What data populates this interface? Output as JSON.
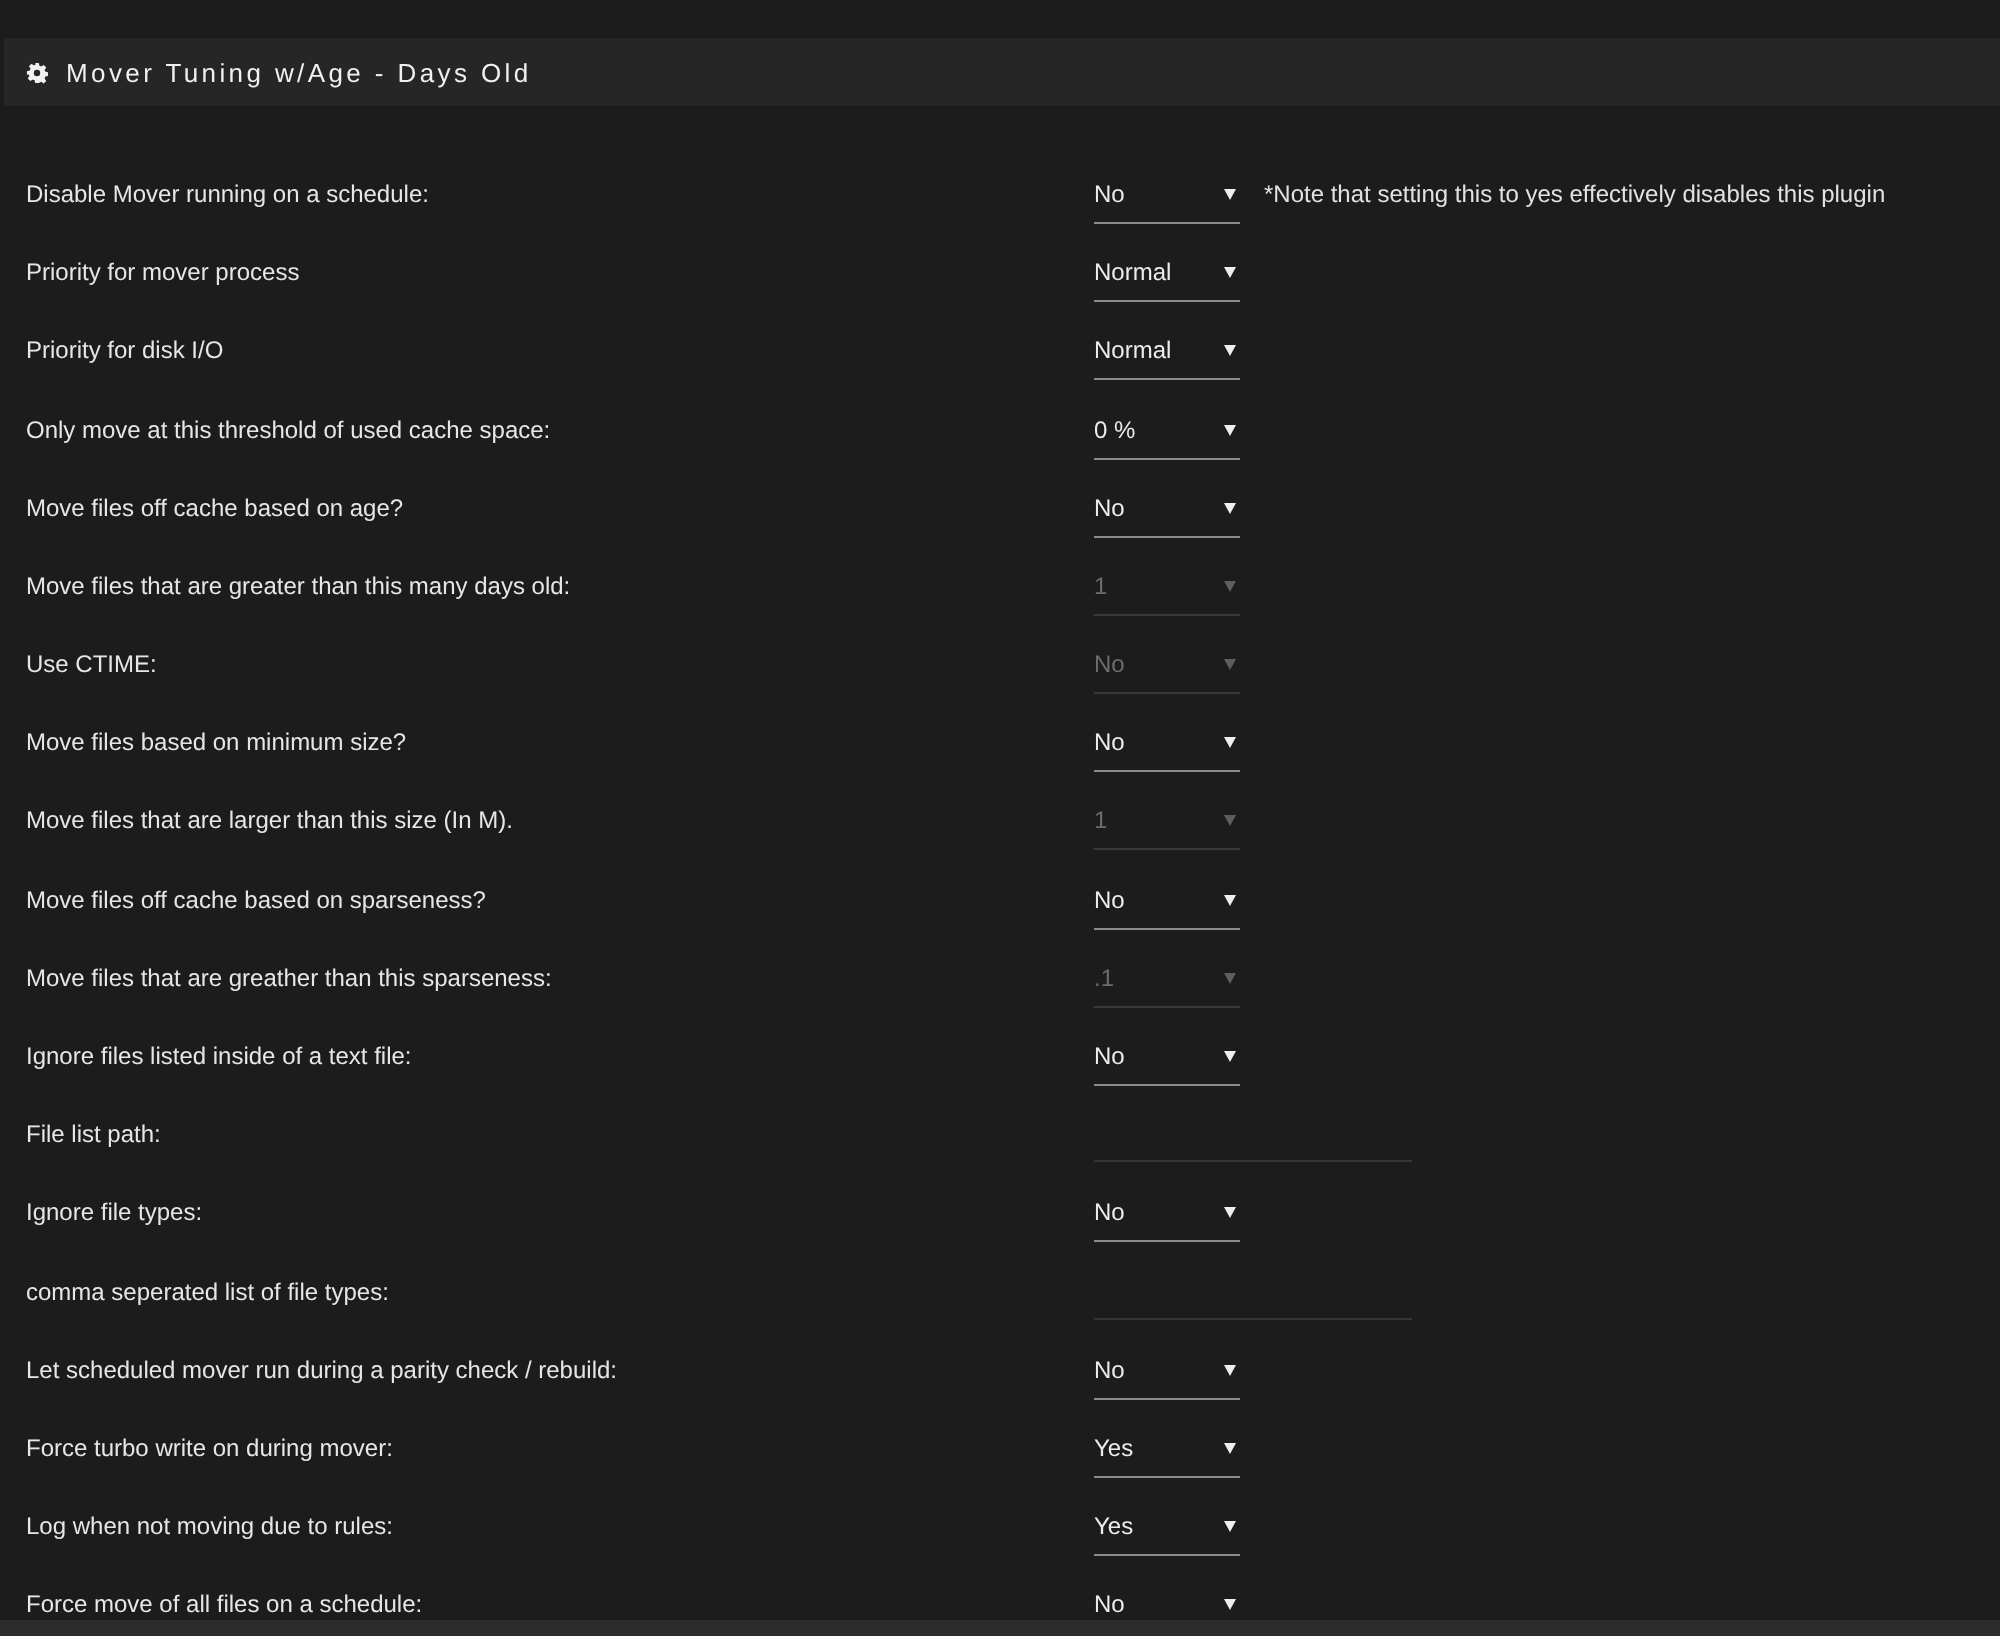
{
  "header": {
    "title": "Mover Tuning w/Age - Days Old"
  },
  "rows": [
    {
      "label": "Disable Mover running on a schedule:",
      "kind": "select",
      "value": "No",
      "disabled": false,
      "note": "*Note that setting this to yes effectively disables this plugin"
    },
    {
      "label": "Priority for mover process",
      "kind": "select",
      "value": "Normal",
      "disabled": false
    },
    {
      "label": "Priority for disk I/O",
      "kind": "select",
      "value": "Normal",
      "disabled": false
    },
    {
      "label": "Only move at this threshold of used cache space:",
      "kind": "select",
      "value": "0 %",
      "disabled": false
    },
    {
      "label": "Move files off cache based on age?",
      "kind": "select",
      "value": "No",
      "disabled": false
    },
    {
      "label": "Move files that are greater than this many days old:",
      "kind": "select",
      "value": "1",
      "disabled": true
    },
    {
      "label": "Use CTIME:",
      "kind": "select",
      "value": "No",
      "disabled": true
    },
    {
      "label": "Move files based on minimum size?",
      "kind": "select",
      "value": "No",
      "disabled": false
    },
    {
      "label": "Move files that are larger than this size (In M).",
      "kind": "select",
      "value": "1",
      "disabled": true
    },
    {
      "label": "Move files off cache based on sparseness?",
      "kind": "select",
      "value": "No",
      "disabled": false
    },
    {
      "label": "Move files that are greather than this sparseness:",
      "kind": "select",
      "value": ".1",
      "disabled": true
    },
    {
      "label": "Ignore files listed inside of a text file:",
      "kind": "select",
      "value": "No",
      "disabled": false
    },
    {
      "label": "File list path:",
      "kind": "text",
      "disabled": true
    },
    {
      "label": "Ignore file types:",
      "kind": "select",
      "value": "No",
      "disabled": false
    },
    {
      "label": "comma seperated list of file types:",
      "kind": "text",
      "disabled": true
    },
    {
      "label": "Let scheduled mover run during a parity check / rebuild:",
      "kind": "select",
      "value": "No",
      "disabled": false
    },
    {
      "label": "Force turbo write on during mover:",
      "kind": "select",
      "value": "Yes",
      "disabled": false
    },
    {
      "label": "Log when not moving due to rules:",
      "kind": "select",
      "value": "Yes",
      "disabled": false
    },
    {
      "label": "Force move of all files on a schedule:",
      "kind": "select",
      "value": "No",
      "disabled": false
    }
  ]
}
